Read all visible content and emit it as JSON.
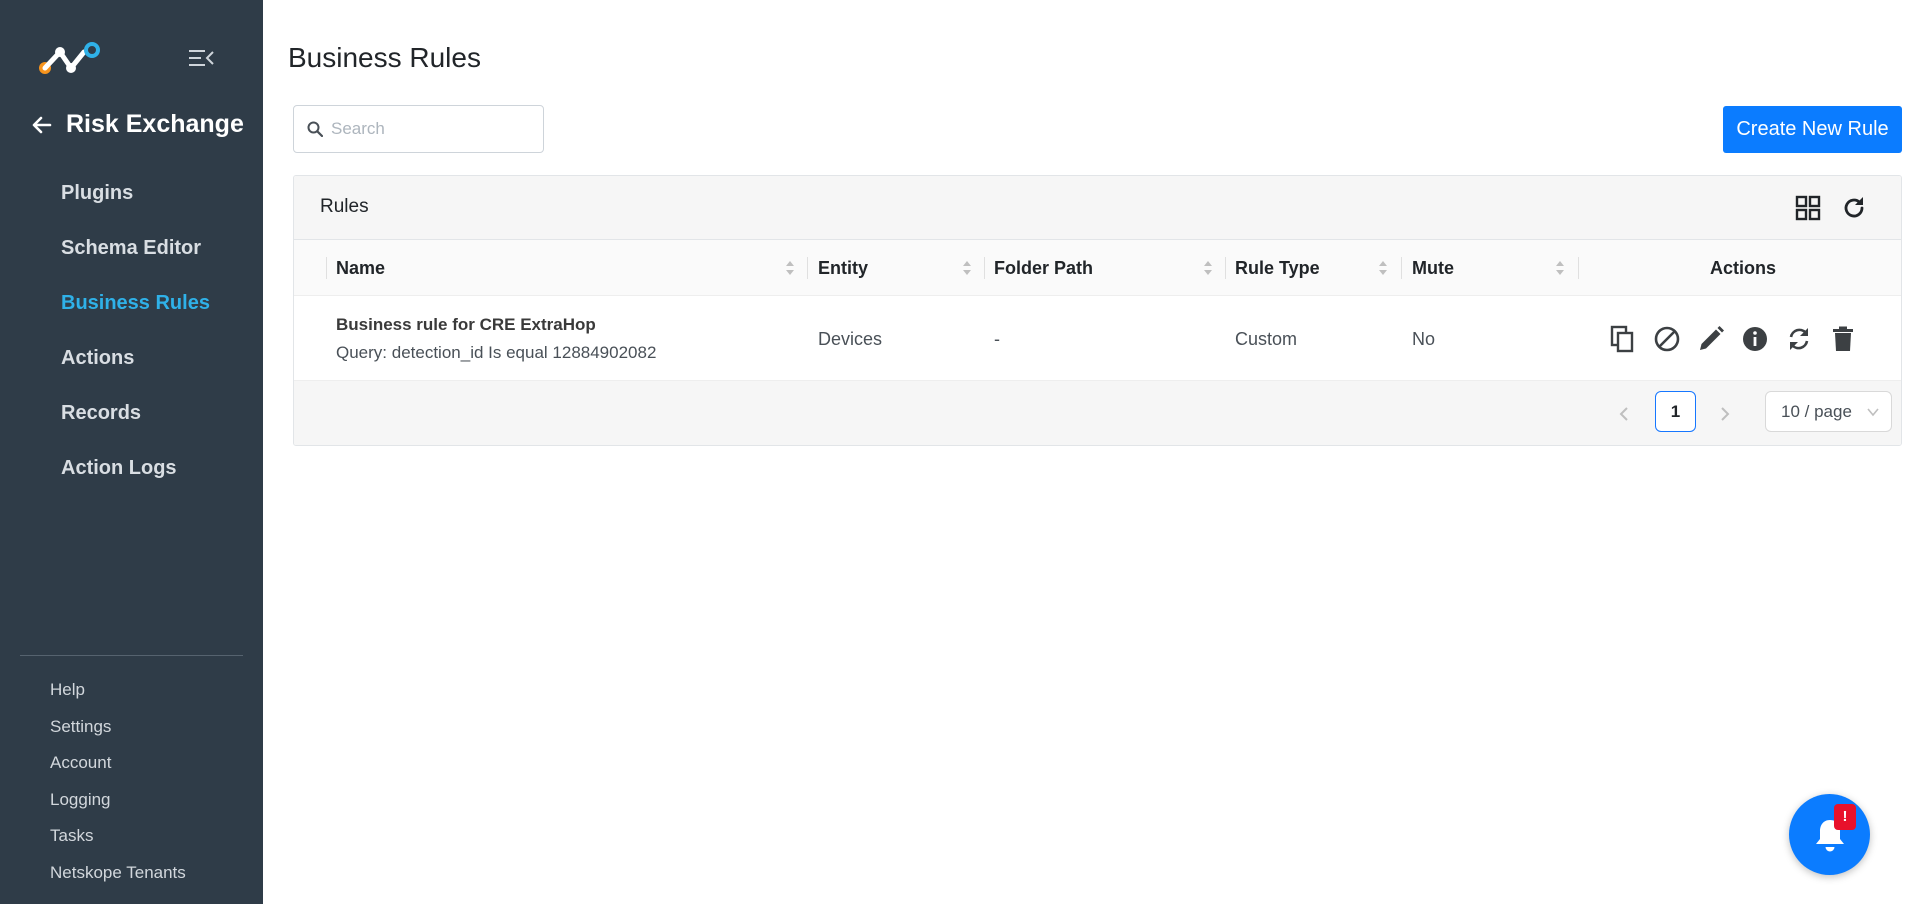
{
  "sidebar": {
    "back_title": "Risk Exchange",
    "nav_items": [
      {
        "label": "Plugins",
        "active": false
      },
      {
        "label": "Schema Editor",
        "active": false
      },
      {
        "label": "Business Rules",
        "active": true
      },
      {
        "label": "Actions",
        "active": false
      },
      {
        "label": "Records",
        "active": false
      },
      {
        "label": "Action Logs",
        "active": false
      }
    ],
    "bottom_items": [
      "Help",
      "Settings",
      "Account",
      "Logging",
      "Tasks",
      "Netskope Tenants"
    ]
  },
  "main": {
    "page_title": "Business Rules",
    "search_placeholder": "Search",
    "create_button": "Create New Rule",
    "card_title": "Rules",
    "columns": [
      "Name",
      "Entity",
      "Folder Path",
      "Rule Type",
      "Mute",
      "Actions"
    ],
    "rows": [
      {
        "name": "Business rule for CRE ExtraHop",
        "query": "Query: detection_id Is equal 12884902082",
        "entity": "Devices",
        "folder_path": "-",
        "rule_type": "Custom",
        "mute": "No"
      }
    ],
    "row_actions": [
      "copy-icon",
      "disable-icon",
      "edit-icon",
      "info-icon",
      "sync-icon",
      "delete-icon"
    ],
    "pagination": {
      "current_page": "1",
      "page_size": "10 / page"
    }
  },
  "notification": {
    "badge": "!"
  },
  "colors": {
    "sidebar_bg": "#2f3c48",
    "active_nav": "#2fb1e8",
    "primary": "#0b7cff",
    "badge": "#e8112b"
  }
}
